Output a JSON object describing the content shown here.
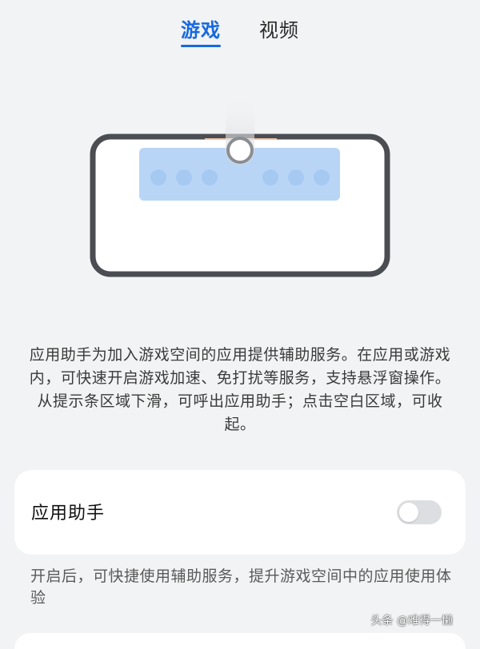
{
  "tabs": [
    {
      "label": "游戏",
      "active": true
    },
    {
      "label": "视频",
      "active": false
    }
  ],
  "illustration": {
    "icon": "phone-landscape-icon",
    "accent_color": "#1769e0",
    "panel_color": "#b9d5f6",
    "dot_color": "#a6c9f2"
  },
  "description": "应用助手为加入游戏空间的应用提供辅助服务。在应用或游戏内，可快速开启游戏加速、免打扰等服务，支持悬浮窗操作。从提示条区域下滑，可呼出应用助手；点击空白区域，可收起。",
  "setting": {
    "label": "应用助手",
    "toggle_on": false
  },
  "hint": "开启后，可快捷使用辅助服务，提升游戏空间中的应用使用体验",
  "watermark": "头条 @难得一懒"
}
